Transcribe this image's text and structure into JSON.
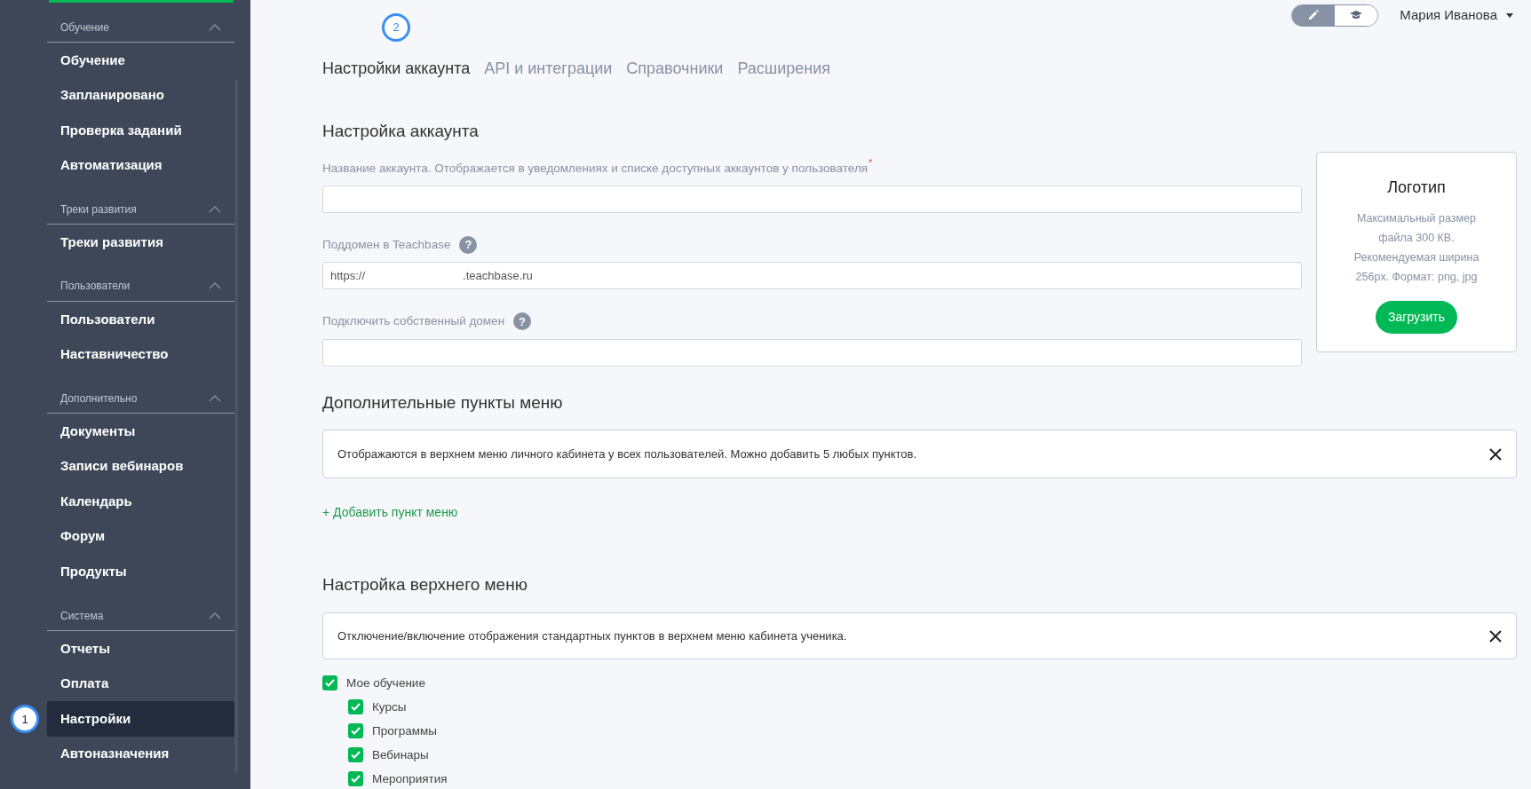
{
  "sidebar": {
    "groups": [
      {
        "title": "Обучение",
        "expanded": true,
        "items": [
          {
            "label": "Обучение",
            "selected": false
          },
          {
            "label": "Запланировано",
            "selected": false
          },
          {
            "label": "Проверка заданий",
            "selected": false
          },
          {
            "label": "Автоматизация",
            "selected": false
          }
        ]
      },
      {
        "title": "Треки развития",
        "expanded": true,
        "items": [
          {
            "label": "Треки развития",
            "selected": false
          }
        ]
      },
      {
        "title": "Пользователи",
        "expanded": true,
        "items": [
          {
            "label": "Пользователи",
            "selected": false
          },
          {
            "label": "Наставничество",
            "selected": false
          }
        ]
      },
      {
        "title": "Дополнительно",
        "expanded": true,
        "items": [
          {
            "label": "Документы",
            "selected": false
          },
          {
            "label": "Записи вебинаров",
            "selected": false
          },
          {
            "label": "Календарь",
            "selected": false
          },
          {
            "label": "Форум",
            "selected": false
          },
          {
            "label": "Продукты",
            "selected": false
          }
        ]
      },
      {
        "title": "Система",
        "expanded": true,
        "items": [
          {
            "label": "Отчеты",
            "selected": false
          },
          {
            "label": "Оплата",
            "selected": false
          },
          {
            "label": "Настройки",
            "selected": true,
            "marker": "1"
          },
          {
            "label": "Автоназначения",
            "selected": false
          }
        ]
      }
    ]
  },
  "mode_toggle": [
    {
      "kind": "edit",
      "selected": true
    },
    {
      "kind": "learn",
      "selected": false
    }
  ],
  "user": {
    "name": "Мария Иванова"
  },
  "tabs": [
    {
      "label": "Настройки аккаунта",
      "selected": true,
      "marker": "2"
    },
    {
      "label": "API и интеграции",
      "selected": false
    },
    {
      "label": "Справочники",
      "selected": false
    },
    {
      "label": "Расширения",
      "selected": false
    }
  ],
  "account": {
    "title": "Настройка аккаунта",
    "fields": [
      {
        "label": "Название аккаунта. Отображается в уведомлениях и списке доступных аккаунтов у пользователя",
        "required_mark": "*"
      },
      {
        "label": "Поддомен в Teachbase",
        "help_icon": "?",
        "prefix": "https://",
        "suffix": ".teachbase.ru"
      },
      {
        "label": "Подключить собственный домен",
        "help_icon": "?"
      }
    ]
  },
  "logo": {
    "title": "Логотип",
    "description": "Максимальный размер файла 300 КВ. Рекомендуемая ширина 256px. Формат: png, jpg",
    "button": "Загрузить"
  },
  "menu_items": {
    "title": "Дополнительные пункты меню",
    "notice": "Отображаются в верхнем меню личного кабинета у всех пользователей. Можно добавить 5 любых пунктов.",
    "add_link": "+ Добавить пункт меню"
  },
  "top_menu": {
    "title": "Настройка верхнего меню",
    "notice": "Отключение/включение отображения стандартных пунктов в верхнем меню кабинета ученика.",
    "items": [
      {
        "label": "Мое обучение",
        "checked": true,
        "children": [
          {
            "label": "Курсы",
            "checked": true
          },
          {
            "label": "Программы",
            "checked": true
          },
          {
            "label": "Вебинары",
            "checked": true
          },
          {
            "label": "Мероприятия",
            "checked": true
          }
        ]
      }
    ]
  }
}
